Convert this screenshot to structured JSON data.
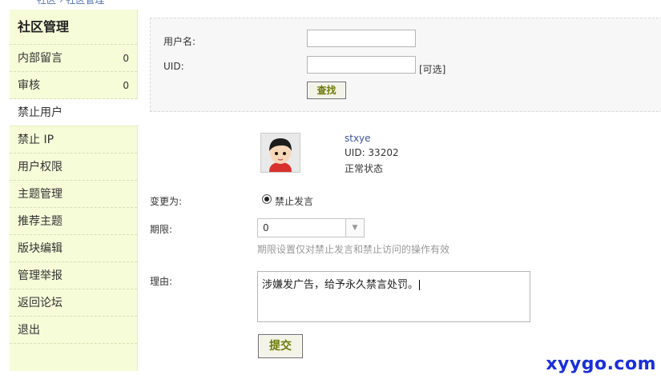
{
  "breadcrumb": "社区 › 社区管理",
  "sidebar": {
    "title": "社区管理",
    "items": [
      {
        "label": "内部留言",
        "count": "0"
      },
      {
        "label": "审核",
        "count": "0"
      },
      {
        "label": "禁止用户",
        "count": ""
      },
      {
        "label": "禁止 IP",
        "count": ""
      },
      {
        "label": "用户权限",
        "count": ""
      },
      {
        "label": "主题管理",
        "count": ""
      },
      {
        "label": "推荐主题",
        "count": ""
      },
      {
        "label": "版块编辑",
        "count": ""
      },
      {
        "label": "管理举报",
        "count": ""
      },
      {
        "label": "返回论坛",
        "count": ""
      },
      {
        "label": "退出",
        "count": ""
      }
    ]
  },
  "search": {
    "username_label": "用户名:",
    "username_value": "",
    "uid_label": "UID:",
    "uid_value": "",
    "uid_optional": "[可选]",
    "search_button": "查找"
  },
  "user": {
    "name": "stxye",
    "uid": "UID: 33202",
    "status": "正常状态"
  },
  "form": {
    "change_label": "变更为:",
    "option_label": "禁止发言",
    "period_label": "期限:",
    "period_value": "0",
    "period_hint": "期限设置仅对禁止发言和禁止访问的操作有效",
    "reason_label": "理由:",
    "reason_value": "涉嫌发广告，给予永久禁言处罚。",
    "submit_button": "提交"
  },
  "watermark": "xyygo.com"
}
